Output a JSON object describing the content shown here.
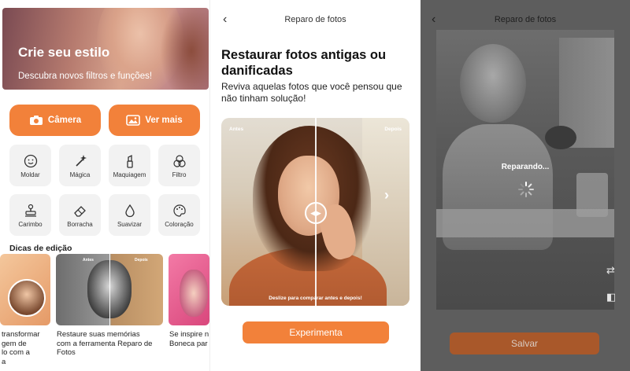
{
  "panel1": {
    "hero": {
      "title": "Crie seu estilo",
      "subtitle": "Descubra novos filtros e funções!"
    },
    "buttons": {
      "camera": "Câmera",
      "more": "Ver mais"
    },
    "tools": [
      {
        "label": "Moldar",
        "icon": "face-smile-icon"
      },
      {
        "label": "Mágica",
        "icon": "magic-wand-icon"
      },
      {
        "label": "Maquiagem",
        "icon": "lipstick-icon"
      },
      {
        "label": "Filtro",
        "icon": "filter-circles-icon"
      },
      {
        "label": "Carimbo",
        "icon": "stamp-icon"
      },
      {
        "label": "Borracha",
        "icon": "eraser-icon"
      },
      {
        "label": "Suavizar",
        "icon": "drop-icon"
      },
      {
        "label": "Coloração",
        "icon": "palette-icon"
      }
    ],
    "tips_title": "Dicas de edição",
    "cards": [
      {
        "lines": [
          "transformar",
          "gem de",
          "lo com a",
          "a"
        ]
      },
      {
        "lines": [
          "Restaure suas memórias",
          "com a ferramenta Reparo de",
          "Fotos"
        ],
        "before": "Antes",
        "after": "Depois"
      },
      {
        "lines": [
          "Se inspire n",
          "Boneca par"
        ]
      }
    ]
  },
  "panel2": {
    "nav_title": "Reparo de fotos",
    "heading": "Restaurar fotos antigas ou danificadas",
    "body": "Reviva aquelas fotos que você pensou que não tinham solução!",
    "tag_before": "Antes",
    "tag_after": "Depois",
    "hint": "Deslize para comparar antes e depois!",
    "cta": "Experimenta"
  },
  "panel3": {
    "nav_title": "Reparo de fotos",
    "status": "Reparando...",
    "save": "Salvar"
  },
  "colors": {
    "accent": "#f2813a",
    "accent_dim": "#a9582a"
  }
}
